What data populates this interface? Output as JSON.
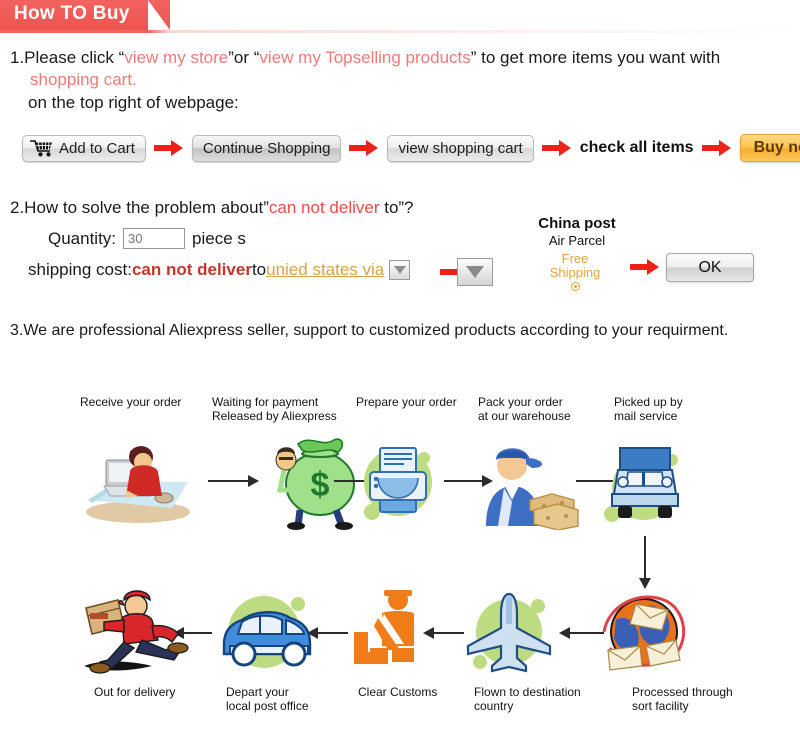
{
  "banner": {
    "title": "How TO Buy"
  },
  "section1": {
    "line1_pre": "1.Please click “",
    "line1_link1": "view my store",
    "line1_mid": "”or “",
    "line1_link2": "view my Topselling products",
    "line1_post": "” to get more items you want with",
    "line2": "shopping cart.",
    "line3": "on the top right of webpage:",
    "buttons": {
      "add_to_cart": "Add to Cart",
      "continue_shopping": "Continue Shopping",
      "view_shopping_cart": "view shopping cart",
      "check_all_items": "check all items",
      "buy_now": "Buy now"
    }
  },
  "section2": {
    "line1_pre": "2.How to solve the problem about”",
    "line1_red": "can not deliver",
    "line1_post": " to”?",
    "quantity_label": "Quantity:",
    "quantity_value": "30",
    "quantity_unit": "piece s",
    "shipping_label": "shipping cost:",
    "shipping_red": "can not deliver",
    "shipping_to": " to ",
    "shipping_country": "unied states via",
    "carrier_name": "China post",
    "carrier_service": "Air Parcel",
    "free_shipping_line1": "Free",
    "free_shipping_line2": "Shipping",
    "ok_button": "OK"
  },
  "section3": {
    "line1": "3.We are professional Aliexpress seller, support to customized products according to your requirment."
  },
  "flow": {
    "steps_top": [
      {
        "label": "Receive your order",
        "icon": "person-at-computer-icon"
      },
      {
        "label": "Waiting for payment\nReleased by Aliexpress",
        "icon": "money-bag-icon"
      },
      {
        "label": "Prepare your order",
        "icon": "printer-icon"
      },
      {
        "label": "Pack your order\nat our warehouse",
        "icon": "warehouse-worker-icon"
      },
      {
        "label": "Picked up by\nmail service",
        "icon": "mail-truck-icon"
      }
    ],
    "steps_bottom": [
      {
        "label": "Out for delivery",
        "icon": "delivery-courier-icon"
      },
      {
        "label": "Depart your\nlocal post office",
        "icon": "post-van-icon"
      },
      {
        "label": "Clear Customs",
        "icon": "customs-officer-icon"
      },
      {
        "label": "Flown to destination\ncountry",
        "icon": "airplane-icon"
      },
      {
        "label": "Processed through\nsort facility",
        "icon": "mail-sort-globe-icon"
      }
    ]
  },
  "colors": {
    "banner_red": "#ee544f",
    "accent_red": "#ee2e24",
    "link_red": "#f07a78",
    "orange": "#e5a33c",
    "buy_now_orange": "#f8ae2b",
    "flow_green": "#b5d96a",
    "flow_blue": "#4a8fd4"
  }
}
